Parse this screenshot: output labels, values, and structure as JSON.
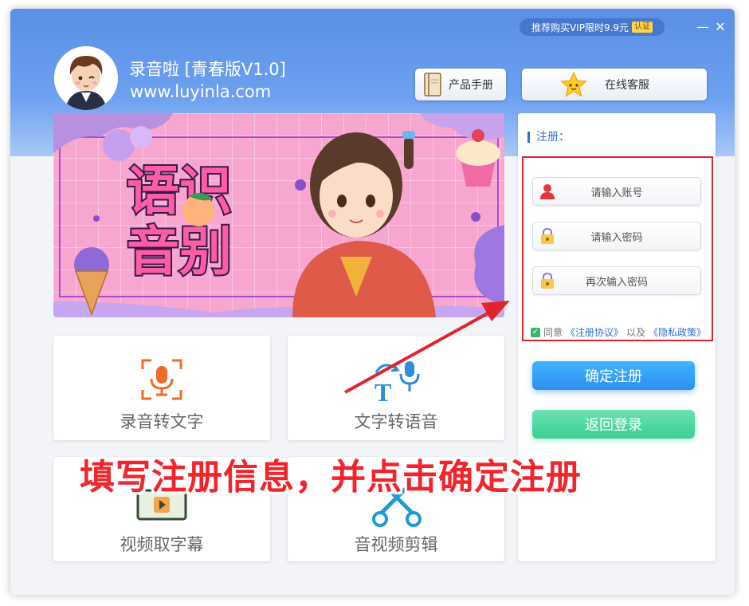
{
  "window": {
    "vip_text": "推荐购买VIP限时9.9元",
    "vip_badge": "认证",
    "minimize_symbol": "—",
    "close_symbol": "✕"
  },
  "app": {
    "title": "录音啦  [青春版V1.0]",
    "url": "www.luyinla.com"
  },
  "header_buttons": {
    "manual_label": "产品手册",
    "service_label": "在线客服"
  },
  "banner": {
    "line1": "语识",
    "line2": "音别"
  },
  "features": [
    {
      "label": "录音转文字",
      "icon": "mic-frame-icon"
    },
    {
      "label": "文字转语音",
      "icon": "text-to-speech-icon"
    },
    {
      "label": "视频取字幕",
      "icon": "video-icon"
    },
    {
      "label": "音视频剪辑",
      "icon": "scissors-icon"
    }
  ],
  "register": {
    "title": "注册：",
    "account_placeholder": "请输入账号",
    "password_placeholder": "请输入密码",
    "confirm_placeholder": "再次输入密码",
    "agree_prefix": "同意",
    "agreement_link": "《注册协议》",
    "agree_and": "以及",
    "privacy_link": "《隐私政策》",
    "confirm_button": "确定注册",
    "back_button": "返回登录"
  },
  "annotation": {
    "text": "填写注册信息，并点击确定注册"
  },
  "colors": {
    "header_blue": "#5a8fe6",
    "link_blue": "#2f6fd6",
    "annotation_red": "#f2242c",
    "confirm_button": "#2e8ef0",
    "back_button": "#3ccf95"
  }
}
